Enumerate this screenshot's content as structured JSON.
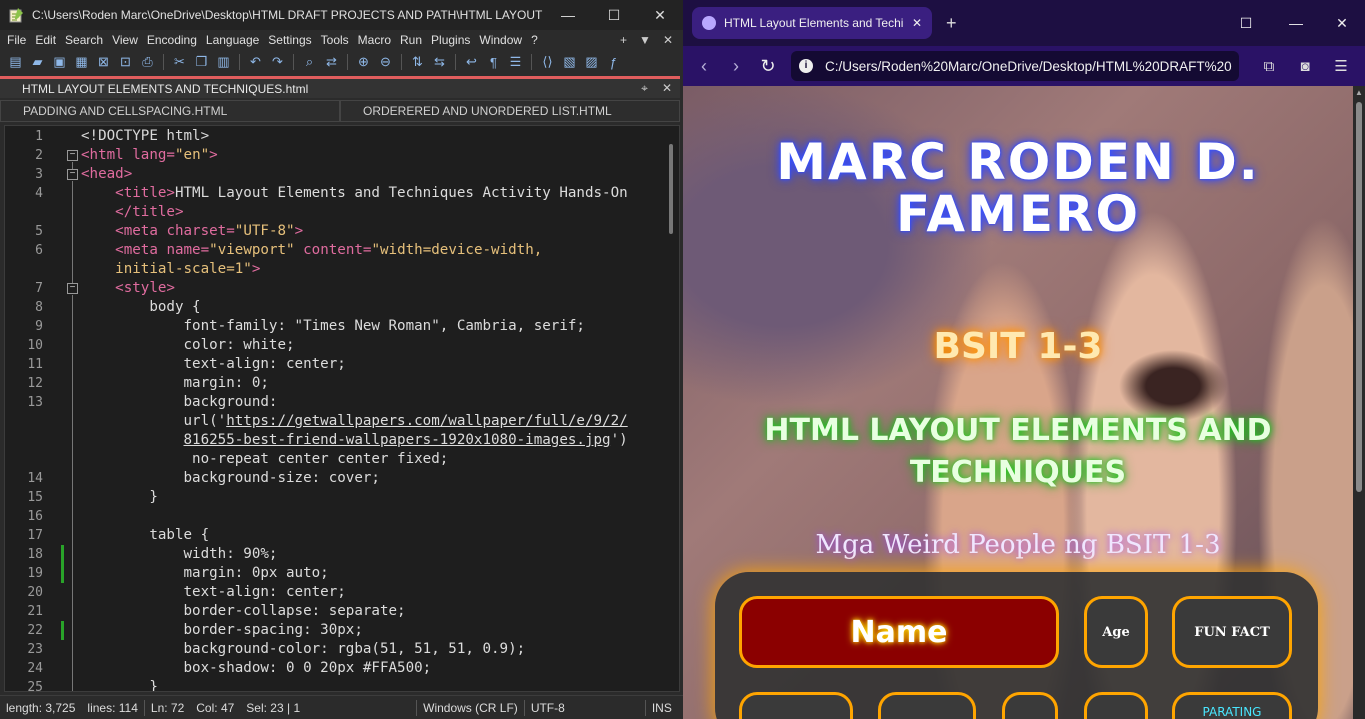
{
  "npp": {
    "title": "C:\\Users\\Roden Marc\\OneDrive\\Desktop\\HTML DRAFT PROJECTS AND PATH\\HTML LAYOUT EL...",
    "window_controls": [
      "—",
      "☐",
      "✕"
    ],
    "menu": [
      "File",
      "Edit",
      "Search",
      "View",
      "Encoding",
      "Language",
      "Settings",
      "Tools",
      "Macro",
      "Run",
      "Plugins",
      "Window",
      "?"
    ],
    "menu_right": [
      "+",
      "▼",
      "✕"
    ],
    "active_tab": "HTML LAYOUT ELEMENTS  AND TECHNIQUES.html",
    "tab_controls": [
      "⌖",
      "✕"
    ],
    "other_tabs": [
      "PADDING AND CELLSPACING.HTML",
      "ORDERERED AND UNORDERED LIST.HTML"
    ],
    "line_numbers": [
      "1",
      "2",
      "3",
      "4",
      "",
      "5",
      "6",
      "",
      "7",
      "8",
      "9",
      "10",
      "11",
      "12",
      "13",
      "",
      "",
      "",
      "14",
      "15",
      "16",
      "17",
      "18",
      "19",
      "20",
      "21",
      "22",
      "23",
      "24",
      "25"
    ],
    "status": {
      "length": "length: 3,725",
      "lines": "lines: 114",
      "ln": "Ln: 72",
      "col": "Col: 47",
      "sel": "Sel: 23 | 1",
      "eol": "Windows (CR LF)",
      "encoding": "UTF-8",
      "mode": "INS"
    }
  },
  "browser": {
    "tab_title": "HTML Layout Elements and Techi",
    "tab_close": "✕",
    "new_tab": "+",
    "window_controls": [
      "—",
      "☐",
      "✕"
    ],
    "url": "C:/Users/Roden%20Marc/OneDrive/Desktop/HTML%20DRAFT%20",
    "page": {
      "name": "MARC RODEN D. FAMERO",
      "section": "BSIT 1-3",
      "topic": "HTML LAYOUT ELEMENTS AND TECHNIQUES",
      "caption": "Mga Weird People ng BSIT 1-3",
      "table_headers": [
        "Name",
        "Age",
        "FUN FACT"
      ],
      "row2_partial": "PARATING"
    }
  }
}
